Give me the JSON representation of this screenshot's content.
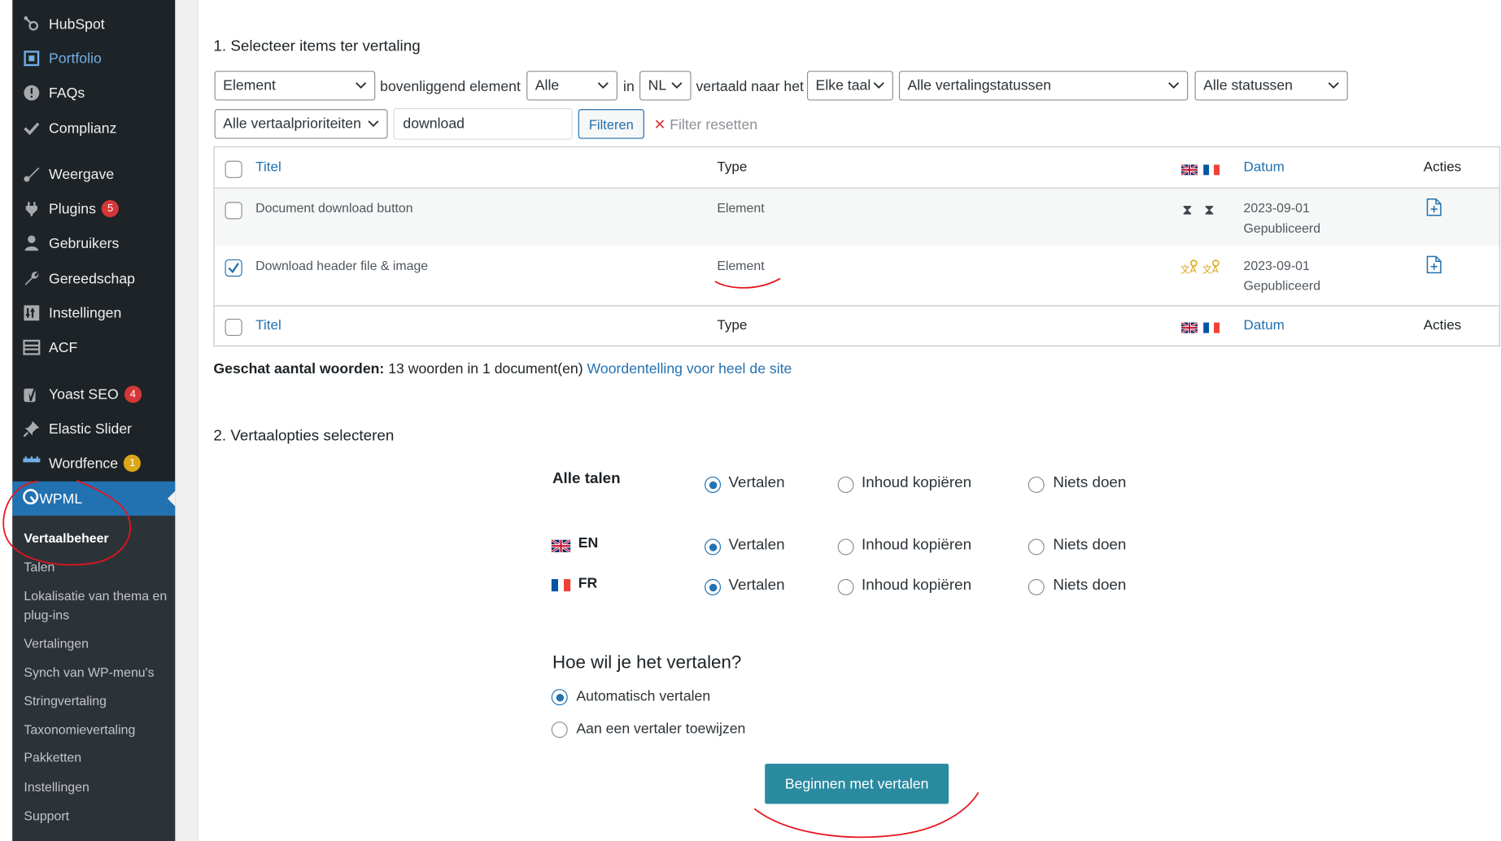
{
  "sidebar": {
    "items": [
      {
        "label": "HubSpot",
        "icon": "hubspot-icon"
      },
      {
        "label": "Portfolio",
        "icon": "portfolio-icon"
      },
      {
        "label": "FAQs",
        "icon": "info-icon"
      },
      {
        "label": "Complianz",
        "icon": "check-icon"
      },
      {
        "label": "Weergave",
        "icon": "brush-icon"
      },
      {
        "label": "Plugins",
        "icon": "plugin-icon",
        "badge": "5"
      },
      {
        "label": "Gebruikers",
        "icon": "users-icon"
      },
      {
        "label": "Gereedschap",
        "icon": "wrench-icon"
      },
      {
        "label": "Instellingen",
        "icon": "settings-icon"
      },
      {
        "label": "ACF",
        "icon": "acf-icon"
      },
      {
        "label": "Yoast SEO",
        "icon": "yoast-icon",
        "badge": "4"
      },
      {
        "label": "Elastic Slider",
        "icon": "pin-icon"
      },
      {
        "label": "Wordfence",
        "icon": "wordfence-icon",
        "badge": "1"
      }
    ],
    "active": {
      "label": "WPML",
      "icon": "wpml-icon"
    },
    "submenu": [
      "Vertaalbeheer",
      "Talen",
      "Lokalisatie van thema en plug-ins",
      "Vertalingen",
      "Synch van WP-menu's",
      "Stringvertaling",
      "Taxonomievertaling",
      "Pakketten",
      "Instellingen",
      "Support"
    ]
  },
  "section1": {
    "title": "1. Selecteer items ter vertaling",
    "filters": {
      "type": "Element",
      "parent_label": "bovenliggend element",
      "parent": "Alle",
      "in_label": "in",
      "lang": "NL",
      "translated_label": "vertaald naar het",
      "target_lang": "Elke taal",
      "translation_status": "Alle vertalingstatussen",
      "status": "Alle statussen",
      "priority": "Alle vertaalprioriteiten",
      "search_value": "download",
      "filter_button": "Filteren",
      "reset": "Filter resetten"
    },
    "table": {
      "headers": {
        "title": "Titel",
        "type": "Type",
        "date": "Datum",
        "actions": "Acties"
      },
      "rows": [
        {
          "title": "Document download button",
          "type": "Element",
          "date": "2023-09-01",
          "status": "Gepubliceerd",
          "checked": false
        },
        {
          "title": "Download header file & image",
          "type": "Element",
          "date": "2023-09-01",
          "status": "Gepubliceerd",
          "checked": true
        }
      ]
    },
    "word_count_label": "Geschat aantal woorden:",
    "word_count_text": "13 woorden in 1 document(en)",
    "word_count_link": "Woordentelling voor heel de site"
  },
  "section2": {
    "title": "2. Vertaalopties selecteren",
    "options": [
      "Vertalen",
      "Inhoud kopiëren",
      "Niets doen"
    ],
    "rows": [
      {
        "label": "Alle talen",
        "selected": 0
      },
      {
        "label": "EN",
        "selected": 0
      },
      {
        "label": "FR",
        "selected": 0
      }
    ],
    "how_title": "Hoe wil je het vertalen?",
    "how_options": [
      "Automatisch vertalen",
      "Aan een vertaler toewijzen"
    ],
    "how_selected": 0,
    "start_button": "Beginnen met vertalen"
  },
  "colors": {
    "sidebar_bg": "#1d2327",
    "accent": "#2271b1",
    "primary_button": "#2a8aa0",
    "annotation": "#e8141c"
  }
}
